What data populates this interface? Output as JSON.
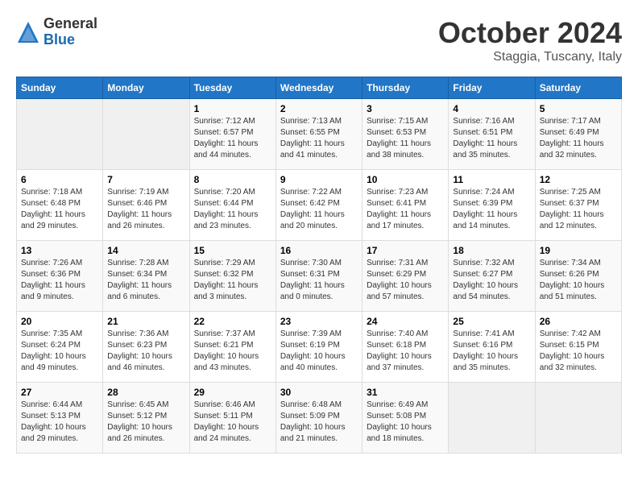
{
  "header": {
    "logo_general": "General",
    "logo_blue": "Blue",
    "month": "October 2024",
    "location": "Staggia, Tuscany, Italy"
  },
  "columns": [
    "Sunday",
    "Monday",
    "Tuesday",
    "Wednesday",
    "Thursday",
    "Friday",
    "Saturday"
  ],
  "weeks": [
    [
      {
        "day": "",
        "info": ""
      },
      {
        "day": "",
        "info": ""
      },
      {
        "day": "1",
        "info": "Sunrise: 7:12 AM\nSunset: 6:57 PM\nDaylight: 11 hours\nand 44 minutes."
      },
      {
        "day": "2",
        "info": "Sunrise: 7:13 AM\nSunset: 6:55 PM\nDaylight: 11 hours\nand 41 minutes."
      },
      {
        "day": "3",
        "info": "Sunrise: 7:15 AM\nSunset: 6:53 PM\nDaylight: 11 hours\nand 38 minutes."
      },
      {
        "day": "4",
        "info": "Sunrise: 7:16 AM\nSunset: 6:51 PM\nDaylight: 11 hours\nand 35 minutes."
      },
      {
        "day": "5",
        "info": "Sunrise: 7:17 AM\nSunset: 6:49 PM\nDaylight: 11 hours\nand 32 minutes."
      }
    ],
    [
      {
        "day": "6",
        "info": "Sunrise: 7:18 AM\nSunset: 6:48 PM\nDaylight: 11 hours\nand 29 minutes."
      },
      {
        "day": "7",
        "info": "Sunrise: 7:19 AM\nSunset: 6:46 PM\nDaylight: 11 hours\nand 26 minutes."
      },
      {
        "day": "8",
        "info": "Sunrise: 7:20 AM\nSunset: 6:44 PM\nDaylight: 11 hours\nand 23 minutes."
      },
      {
        "day": "9",
        "info": "Sunrise: 7:22 AM\nSunset: 6:42 PM\nDaylight: 11 hours\nand 20 minutes."
      },
      {
        "day": "10",
        "info": "Sunrise: 7:23 AM\nSunset: 6:41 PM\nDaylight: 11 hours\nand 17 minutes."
      },
      {
        "day": "11",
        "info": "Sunrise: 7:24 AM\nSunset: 6:39 PM\nDaylight: 11 hours\nand 14 minutes."
      },
      {
        "day": "12",
        "info": "Sunrise: 7:25 AM\nSunset: 6:37 PM\nDaylight: 11 hours\nand 12 minutes."
      }
    ],
    [
      {
        "day": "13",
        "info": "Sunrise: 7:26 AM\nSunset: 6:36 PM\nDaylight: 11 hours\nand 9 minutes."
      },
      {
        "day": "14",
        "info": "Sunrise: 7:28 AM\nSunset: 6:34 PM\nDaylight: 11 hours\nand 6 minutes."
      },
      {
        "day": "15",
        "info": "Sunrise: 7:29 AM\nSunset: 6:32 PM\nDaylight: 11 hours\nand 3 minutes."
      },
      {
        "day": "16",
        "info": "Sunrise: 7:30 AM\nSunset: 6:31 PM\nDaylight: 11 hours\nand 0 minutes."
      },
      {
        "day": "17",
        "info": "Sunrise: 7:31 AM\nSunset: 6:29 PM\nDaylight: 10 hours\nand 57 minutes."
      },
      {
        "day": "18",
        "info": "Sunrise: 7:32 AM\nSunset: 6:27 PM\nDaylight: 10 hours\nand 54 minutes."
      },
      {
        "day": "19",
        "info": "Sunrise: 7:34 AM\nSunset: 6:26 PM\nDaylight: 10 hours\nand 51 minutes."
      }
    ],
    [
      {
        "day": "20",
        "info": "Sunrise: 7:35 AM\nSunset: 6:24 PM\nDaylight: 10 hours\nand 49 minutes."
      },
      {
        "day": "21",
        "info": "Sunrise: 7:36 AM\nSunset: 6:23 PM\nDaylight: 10 hours\nand 46 minutes."
      },
      {
        "day": "22",
        "info": "Sunrise: 7:37 AM\nSunset: 6:21 PM\nDaylight: 10 hours\nand 43 minutes."
      },
      {
        "day": "23",
        "info": "Sunrise: 7:39 AM\nSunset: 6:19 PM\nDaylight: 10 hours\nand 40 minutes."
      },
      {
        "day": "24",
        "info": "Sunrise: 7:40 AM\nSunset: 6:18 PM\nDaylight: 10 hours\nand 37 minutes."
      },
      {
        "day": "25",
        "info": "Sunrise: 7:41 AM\nSunset: 6:16 PM\nDaylight: 10 hours\nand 35 minutes."
      },
      {
        "day": "26",
        "info": "Sunrise: 7:42 AM\nSunset: 6:15 PM\nDaylight: 10 hours\nand 32 minutes."
      }
    ],
    [
      {
        "day": "27",
        "info": "Sunrise: 6:44 AM\nSunset: 5:13 PM\nDaylight: 10 hours\nand 29 minutes."
      },
      {
        "day": "28",
        "info": "Sunrise: 6:45 AM\nSunset: 5:12 PM\nDaylight: 10 hours\nand 26 minutes."
      },
      {
        "day": "29",
        "info": "Sunrise: 6:46 AM\nSunset: 5:11 PM\nDaylight: 10 hours\nand 24 minutes."
      },
      {
        "day": "30",
        "info": "Sunrise: 6:48 AM\nSunset: 5:09 PM\nDaylight: 10 hours\nand 21 minutes."
      },
      {
        "day": "31",
        "info": "Sunrise: 6:49 AM\nSunset: 5:08 PM\nDaylight: 10 hours\nand 18 minutes."
      },
      {
        "day": "",
        "info": ""
      },
      {
        "day": "",
        "info": ""
      }
    ]
  ]
}
